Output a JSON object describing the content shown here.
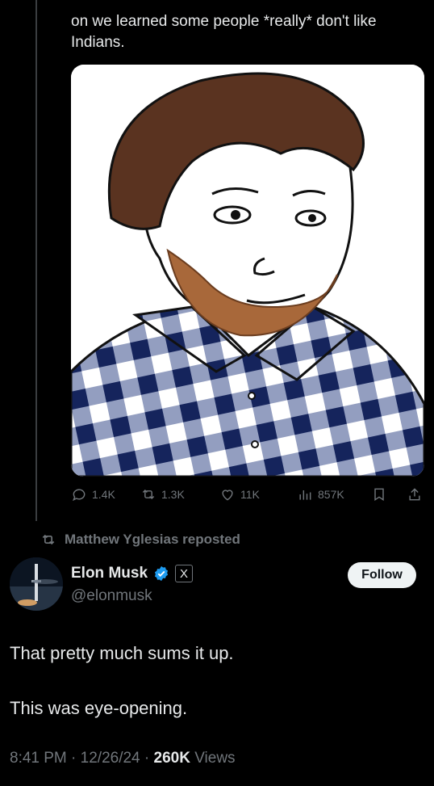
{
  "quoted_post": {
    "text": "on we learned some people *really* don't like Indians.",
    "media": {
      "description_icon": "meme-wojak-plaid-shirt-image"
    },
    "actions": {
      "replies": "1.4K",
      "reposts": "1.3K",
      "likes": "11K",
      "views": "857K"
    }
  },
  "repost_label": "Matthew Yglesias reposted",
  "post": {
    "author_name": "Elon Musk",
    "author_handle": "@elonmusk",
    "affiliation_badge": "X",
    "follow_label": "Follow",
    "text_line1": "That pretty much sums it up.",
    "text_line2": "This was eye-opening.",
    "time": "8:41 PM",
    "date": "12/26/24",
    "views_count": "260K",
    "views_label": "Views"
  },
  "colors": {
    "background": "#000000",
    "text": "#e7e9ea",
    "muted": "#71767b",
    "verified": "#1d9bf0"
  }
}
